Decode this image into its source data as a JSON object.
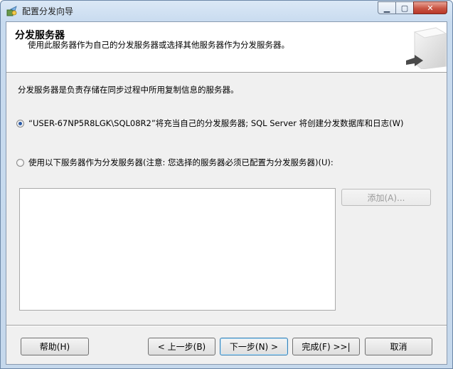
{
  "window": {
    "title": "配置分发向导"
  },
  "header": {
    "title": "分发服务器",
    "subtitle": "使用此服务器作为自己的分发服务器或选择其他服务器作为分发服务器。"
  },
  "description": "分发服务器是负责存储在同步过程中所用复制信息的服务器。",
  "options": {
    "self": {
      "label": "“USER-67NP5R8LGK\\SQL08R2”将充当自己的分发服务器; SQL Server 将创建分发数据库和日志(W)",
      "checked": true
    },
    "other": {
      "label": "使用以下服务器作为分发服务器(注意: 您选择的服务器必须已配置为分发服务器)(U):",
      "checked": false
    }
  },
  "add_button": "添加(A)...",
  "footer": {
    "help": "帮助(H)",
    "back": "< 上一步(B)",
    "next": "下一步(N) >",
    "finish": "完成(F) >>|",
    "cancel": "取消"
  },
  "colors": {
    "accent": "#2a5aa6",
    "close": "#c95443"
  }
}
